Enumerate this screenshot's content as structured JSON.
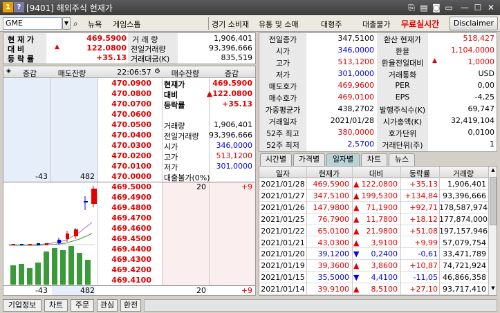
{
  "window": {
    "title": "[9401] 해외주식 현재가",
    "icon1": "1",
    "icon2": "?"
  },
  "toolbar": {
    "symbol_value": "GME",
    "news_label": "뉴욕",
    "company_name": "게임스톱",
    "sector1": "경기 소비재",
    "sector2": "유통 및 소매",
    "size_class": "대형주",
    "loan_status": "대출불가",
    "realtime_label": "무료실시간",
    "disclaimer_label": "Disclaimer"
  },
  "summary": {
    "price_label": "현 재 가",
    "price_value": "469.5900",
    "change_label": "대 비",
    "change_value": "122.0800",
    "change_arrow": "▲",
    "rate_label": "등 락 률",
    "rate_value": "+35.13",
    "volume_label": "거 래 량",
    "volume_value": "1,906,401",
    "prev_volume_label": "전일거래량",
    "prev_volume_value": "93,396,666",
    "amount_label": "거래대금(K)",
    "amount_value": "835,519"
  },
  "orderbook": {
    "headers": {
      "change_l": "증감",
      "sell_rem": "매도잔량",
      "time": "22:06:57",
      "buy_rem": "매수잔량",
      "change_r": "증감"
    },
    "ask_prices": [
      "470.0900",
      "470.0800",
      "470.0700",
      "470.0600",
      "470.0500",
      "470.0400",
      "470.0300",
      "470.0200",
      "470.0100",
      "470.0000"
    ],
    "ask_sell_change": "-43",
    "ask_sell_qty": "482",
    "bid_prices": [
      "469.5000",
      "469.4900",
      "469.4800",
      "469.4700",
      "469.4600",
      "469.4500",
      "469.4400",
      "469.4300",
      "469.4200",
      "469.4100"
    ],
    "bid_buy_qty": "20",
    "bid_buy_change": "+9",
    "info": {
      "cur_label": "현재가",
      "cur_value": "469.5900",
      "chg_label": "대비",
      "chg_value": "▲122.0800",
      "rate_label": "등락률",
      "rate_value": "+35.13",
      "vol_label": "거래량",
      "vol_value": "1,906,401",
      "prev_label": "전일거래량",
      "prev_value": "93,396,666",
      "open_label": "시가",
      "open_value": "346,0000",
      "high_label": "고가",
      "high_value": "513,1200",
      "low_label": "저가",
      "low_value": "301,0000",
      "loan_label": "대출불가(0%)"
    },
    "total_sell_change": "-43",
    "total_sell_qty": "482",
    "total_buy_qty": "20",
    "total_buy_change": "+9"
  },
  "quote": {
    "rows": [
      {
        "l1": "전일종가",
        "v1": "347,5100",
        "l2": "환산 현재가",
        "v2": "518,427"
      },
      {
        "l1": "시가",
        "v1": "346,0000",
        "l2": "환율",
        "v2": "1,104,0000"
      },
      {
        "l1": "고가",
        "v1": "513,1200",
        "l2": "환율전일대비",
        "v2": "1,0000"
      },
      {
        "l1": "저가",
        "v1": "301,0000",
        "l2": "거래통화",
        "v2": "USD"
      },
      {
        "l1": "매도호가",
        "v1": "469,9600",
        "l2": "PER",
        "v2": "0,00"
      },
      {
        "l1": "매수호가",
        "v1": "469,0100",
        "l2": "EPS",
        "v2": "-4,25"
      },
      {
        "l1": "가중평균가",
        "v1": "438,2702",
        "l2": "발행주식수(K)",
        "v2": "69,747"
      },
      {
        "l1": "거래일자",
        "v1": "2021/01/28",
        "l2": "시가총액(K)",
        "v2": "32,419,104"
      },
      {
        "l1": "52주 최고",
        "v1": "380,0000",
        "l2": "호가단위",
        "v2": "0,0100"
      },
      {
        "l1": "52주 최저",
        "v1": "2,5700",
        "l2": "거래단위(주)",
        "v2": "1"
      }
    ]
  },
  "tabs": [
    "시간별",
    "가격별",
    "일자별",
    "차트",
    "뉴스"
  ],
  "daily": {
    "headers": [
      "일자",
      "현재가",
      "대비",
      "등락률",
      "거래량"
    ],
    "rows": [
      {
        "date": "2021/01/28",
        "price": "469,5900",
        "arrow": "▲",
        "chg": "122,0800",
        "rate": "+35,13",
        "vol": "1,906,401",
        "dir": "up"
      },
      {
        "date": "2021/01/27",
        "price": "347,5100",
        "arrow": "▲",
        "chg": "199,5300",
        "rate": "+134,84",
        "vol": "93,396,666",
        "dir": "up"
      },
      {
        "date": "2021/01/26",
        "price": "147,9800",
        "arrow": "▲",
        "chg": "71,1900",
        "rate": "+92,71",
        "vol": "178,587,974",
        "dir": "up"
      },
      {
        "date": "2021/01/25",
        "price": "76,7900",
        "arrow": "▲",
        "chg": "11,7800",
        "rate": "+18,12",
        "vol": "177,874,000",
        "dir": "up"
      },
      {
        "date": "2021/01/22",
        "price": "65,0100",
        "arrow": "▲",
        "chg": "21,9800",
        "rate": "+51,08",
        "vol": "197,157,946",
        "dir": "up"
      },
      {
        "date": "2021/01/21",
        "price": "43,0300",
        "arrow": "▲",
        "chg": "3,9100",
        "rate": "+9,99",
        "vol": "57,079,754",
        "dir": "up"
      },
      {
        "date": "2021/01/20",
        "price": "39,1200",
        "arrow": "▼",
        "chg": "0,2400",
        "rate": "-0,61",
        "vol": "33,471,789",
        "dir": "down"
      },
      {
        "date": "2021/01/19",
        "price": "39,3600",
        "arrow": "▲",
        "chg": "3,8600",
        "rate": "+10,87",
        "vol": "74,721,924",
        "dir": "up"
      },
      {
        "date": "2021/01/15",
        "price": "35,5000",
        "arrow": "▼",
        "chg": "4,4100",
        "rate": "-11,05",
        "vol": "46,866,358",
        "dir": "down"
      },
      {
        "date": "2021/01/14",
        "price": "39,9100",
        "arrow": "▲",
        "chg": "8,5100",
        "rate": "+27,10",
        "vol": "93,717,410",
        "dir": "up"
      }
    ]
  },
  "bottom_tabs": [
    "기업정보",
    "차트",
    "주문",
    "관심",
    "환전"
  ],
  "colors": {
    "up": "#e00000",
    "down": "#0000e0",
    "active_tab": "#b8d4d8"
  }
}
